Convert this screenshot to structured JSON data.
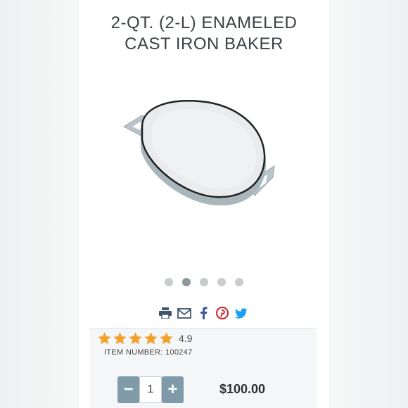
{
  "product": {
    "title_line1": "2-QT. (2-L) ENAMELED",
    "title_line2": "CAST IRON BAKER",
    "rating_value": "4.9",
    "rating_stars": 4.9,
    "item_number": "ITEM NUMBER: 100247",
    "quantity": "1",
    "price": "$100.00"
  },
  "carousel": {
    "dot_count": 5,
    "active_index": 1
  },
  "share_icons": [
    "print-icon",
    "email-icon",
    "facebook-icon",
    "pinterest-icon",
    "twitter-icon"
  ],
  "colors": {
    "accent": "#7f9aa8",
    "star": "#f2a12e",
    "facebook": "#3b5998",
    "pinterest": "#cb2027",
    "twitter": "#1da1f2"
  }
}
